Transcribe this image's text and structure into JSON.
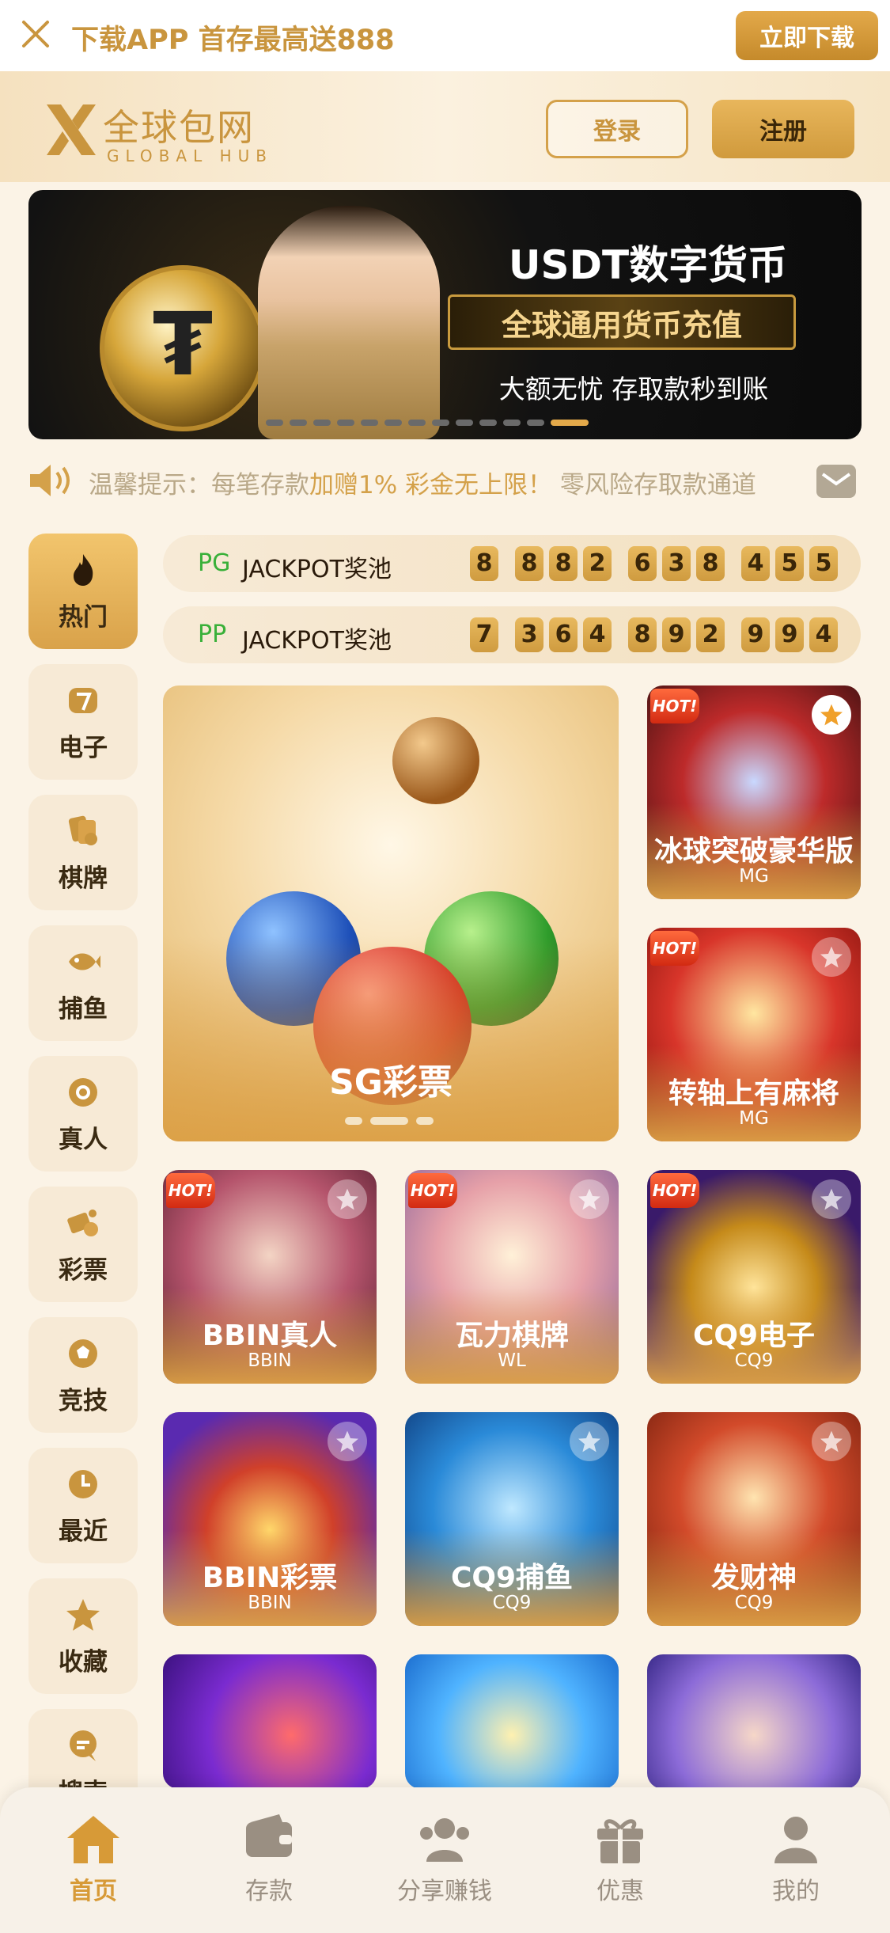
{
  "top_bar": {
    "promo_text": "下载APP 首存最高送888",
    "download_label": "立即下载"
  },
  "header": {
    "logo_cn": "全球包网",
    "logo_en": "GLOBAL HUB",
    "login_label": "登录",
    "register_label": "注册"
  },
  "banner": {
    "title": "USDT数字货币",
    "subtitle": "全球通用货币充值",
    "tagline": "大额无忧 存取款秒到账",
    "slide_count": 13,
    "active_slide": 12
  },
  "notice": {
    "prefix": "温馨提示：每笔存款",
    "highlight": "加赠1% 彩金无上限！",
    "suffix": "零风险存取款通道"
  },
  "sidebar": {
    "items": [
      {
        "label": "热门",
        "icon": "flame-icon",
        "active": true
      },
      {
        "label": "电子",
        "icon": "slot-seven-icon"
      },
      {
        "label": "棋牌",
        "icon": "cards-icon"
      },
      {
        "label": "捕鱼",
        "icon": "fish-icon"
      },
      {
        "label": "真人",
        "icon": "chip-icon"
      },
      {
        "label": "彩票",
        "icon": "lottery-icon"
      },
      {
        "label": "竞技",
        "icon": "soccer-ball-icon"
      },
      {
        "label": "最近",
        "icon": "clock-icon"
      },
      {
        "label": "收藏",
        "icon": "star-icon"
      },
      {
        "label": "搜索",
        "icon": "search-chat-icon"
      }
    ]
  },
  "jackpots": [
    {
      "provider": "PG",
      "label": "JACKPOT奖池",
      "digits": [
        "8",
        "8",
        "8",
        "2",
        "6",
        "3",
        "8",
        "4",
        "5",
        "5"
      ]
    },
    {
      "provider": "PP",
      "label": "JACKPOT奖池",
      "digits": [
        "7",
        "3",
        "6",
        "4",
        "8",
        "9",
        "2",
        "9",
        "9",
        "4"
      ]
    }
  ],
  "featured": {
    "title": "SG彩票"
  },
  "games": [
    {
      "title": "冰球突破豪华版",
      "provider": "MG",
      "hot": true,
      "fav": true
    },
    {
      "title": "转轴上有麻将",
      "provider": "MG",
      "hot": true,
      "fav": false
    },
    {
      "title": "BBIN真人",
      "provider": "BBIN",
      "hot": true,
      "fav": false
    },
    {
      "title": "瓦力棋牌",
      "provider": "WL",
      "hot": true,
      "fav": false
    },
    {
      "title": "CQ9电子",
      "provider": "CQ9",
      "hot": true,
      "fav": false
    },
    {
      "title": "BBIN彩票",
      "provider": "BBIN",
      "hot": false,
      "fav": false
    },
    {
      "title": "CQ9捕鱼",
      "provider": "CQ9",
      "hot": false,
      "fav": false
    },
    {
      "title": "发财神",
      "provider": "CQ9",
      "hot": false,
      "fav": false
    }
  ],
  "hot_badge": "HOT!",
  "bottom_nav": [
    {
      "label": "首页",
      "icon": "home-icon",
      "active": true
    },
    {
      "label": "存款",
      "icon": "wallet-icon"
    },
    {
      "label": "分享赚钱",
      "icon": "users-icon"
    },
    {
      "label": "优惠",
      "icon": "gift-icon"
    },
    {
      "label": "我的",
      "icon": "user-icon"
    }
  ],
  "colors": {
    "accent": "#d4a14a",
    "background": "#fbf3e6",
    "provider_green": "#39b039"
  }
}
